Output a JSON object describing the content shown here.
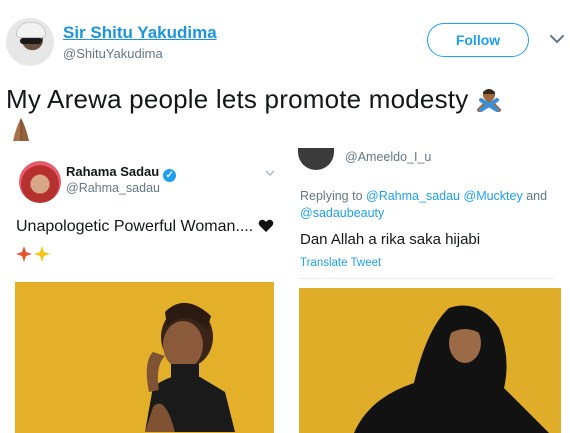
{
  "tweet": {
    "author_name": "Sir Shitu Yakudima",
    "author_handle": "@ShituYakudima",
    "follow_label": "Follow",
    "text": "My Arewa people lets promote modesty"
  },
  "embedded_left": {
    "name": "Rahama Sadau",
    "handle": "@Rahma_sadau",
    "text": "Unapologetic Powerful Woman...."
  },
  "embedded_right": {
    "handle_partial": "@Ameeldo_I_u",
    "replying_prefix": "Replying to ",
    "reply_user_1": "@Rahma_sadau",
    "reply_user_2": "@Mucktey",
    "reply_and": " and",
    "reply_user_3": "@sadaubeauty",
    "text": "Dan Allah a rika saka hijabi",
    "translate_label": "Translate Tweet"
  },
  "colors": {
    "link_blue": "#1b95e0",
    "twitter_blue": "#1da1f2",
    "muted_gray": "#657786",
    "photo_mustard": "#e4b02a"
  },
  "icons": [
    "chevron-down-icon",
    "verified-badge-icon",
    "person-gesturing-no-emoji",
    "folded-hands-emoji",
    "black-heart-emoji",
    "sparkles-emoji"
  ]
}
